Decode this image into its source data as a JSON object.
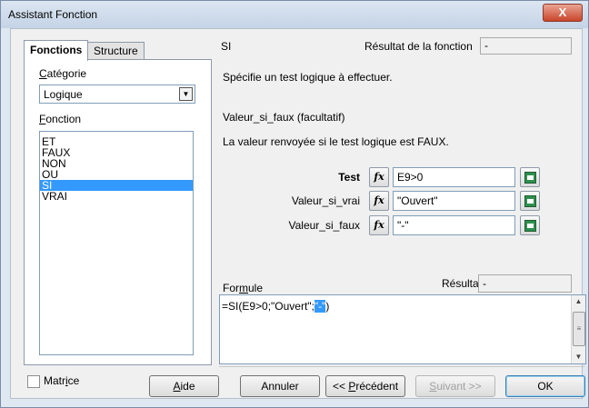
{
  "window": {
    "title": "Assistant Fonction",
    "close_glyph": "X"
  },
  "tabs": [
    {
      "label": "Fonctions",
      "active": true
    },
    {
      "label": "Structure",
      "active": false
    }
  ],
  "category": {
    "label_accel": "C",
    "label_rest": "atégorie",
    "value": "Logique"
  },
  "function_list": {
    "label_accel": "F",
    "label_rest": "onction",
    "items": [
      {
        "label": "ET",
        "selected": false
      },
      {
        "label": "FAUX",
        "selected": false
      },
      {
        "label": "NON",
        "selected": false
      },
      {
        "label": "OU",
        "selected": false
      },
      {
        "label": "SI",
        "selected": true
      },
      {
        "label": "VRAI",
        "selected": false
      }
    ]
  },
  "function_info": {
    "name": "SI",
    "result_label": "Résultat de la fonction",
    "result_value": "-",
    "description": "Spécifie un test logique à effectuer.",
    "param_title": "Valeur_si_faux (facultatif)",
    "param_description": "La valeur renvoyée si le test logique est FAUX."
  },
  "arguments": [
    {
      "label": "Test",
      "bold": true,
      "value": "E9>0"
    },
    {
      "label": "Valeur_si_vrai",
      "bold": false,
      "value": "\"Ouvert\""
    },
    {
      "label": "Valeur_si_faux",
      "bold": false,
      "value": "\"-\""
    }
  ],
  "formula": {
    "label_pre": "For",
    "label_accel": "m",
    "label_post": "ule",
    "result_label": "Résultat",
    "result_value": "-",
    "text_before": "=SI(E9>0;\"Ouvert\";",
    "text_selected": "\"-\"",
    "text_after": ")"
  },
  "matrix_checkbox": {
    "label_pre": "Matr",
    "label_accel": "i",
    "label_post": "ce",
    "checked": false
  },
  "buttons": {
    "help": {
      "accel": "A",
      "rest": "ide"
    },
    "cancel": "Annuler",
    "previous": {
      "pre": "<< ",
      "accel": "P",
      "rest": "récédent"
    },
    "next": {
      "accel": "S",
      "rest": "uivant >>"
    },
    "ok": "OK"
  }
}
